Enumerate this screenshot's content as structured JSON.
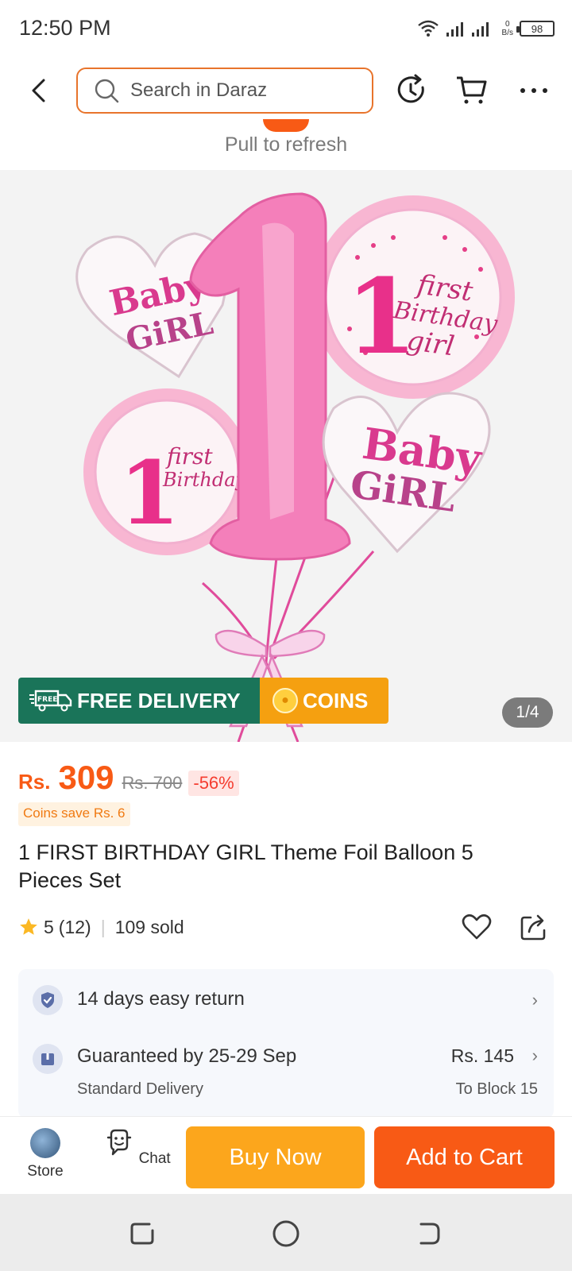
{
  "status_bar": {
    "time": "12:50 PM",
    "net_speed_value": "0",
    "net_speed_unit": "B/s",
    "battery": "98"
  },
  "top_bar": {
    "search_placeholder": "Search in Daraz"
  },
  "pull_to_refresh": "Pull to refresh",
  "gallery": {
    "page_indicator": "1/4",
    "badges": {
      "free_icon_text": "FREE",
      "free_delivery": "FREE DELIVERY",
      "coins": "COINS"
    },
    "balloons": {
      "heart_text_1": "Baby",
      "heart_text_2": "GiRL",
      "round_number": "1",
      "round_text_1": "first",
      "round_text_2": "Birthday",
      "round_text_3": "girl"
    }
  },
  "product": {
    "currency": "Rs.",
    "price": "309",
    "original_price": "Rs. 700",
    "discount": "-56%",
    "coins_save": "Coins save Rs. 6",
    "title": "1 FIRST BIRTHDAY GIRL Theme Foil Balloon 5 Pieces Set",
    "rating": "5",
    "reviews": "(12)",
    "sold": "109 sold"
  },
  "info": {
    "return_text": "14 days easy return",
    "guarantee_text": "Guaranteed by 25-29 Sep",
    "delivery_type": "Standard Delivery",
    "shipping_price": "Rs. 145",
    "ship_to": "To Block 15"
  },
  "bottom_bar": {
    "store_label": "Store",
    "chat_label": "Chat",
    "buy_now_label": "Buy Now",
    "add_to_cart_label": "Add to Cart"
  },
  "colors": {
    "brand_orange": "#f85a15",
    "buy_now": "#fca61c",
    "free_delivery_green": "#1a7459",
    "coins_orange": "#f5a010"
  }
}
